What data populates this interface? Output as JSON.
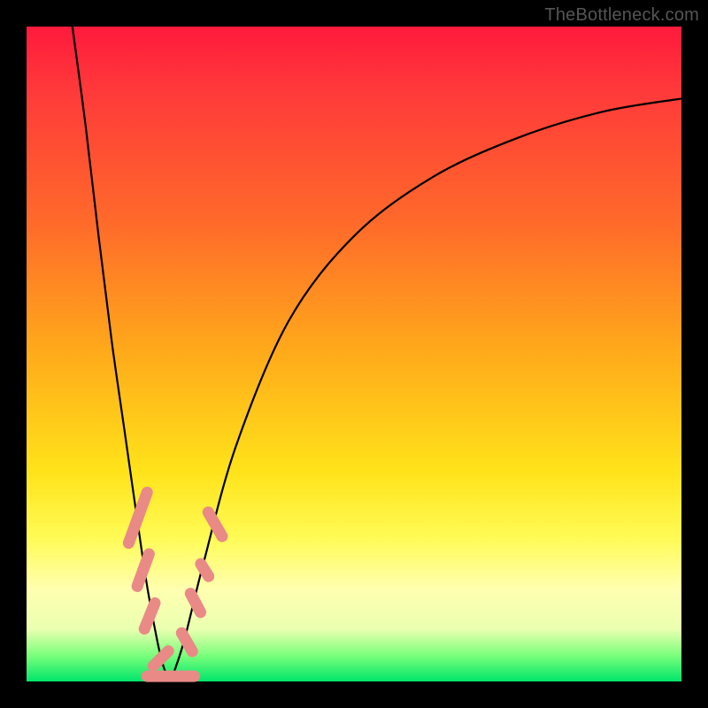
{
  "attribution": "TheBottleneck.com",
  "colors": {
    "frame": "#000000",
    "attribution_text": "#555555",
    "curve": "#000000",
    "marker": "#e98a87",
    "gradient_stops": [
      "#ff1a3c",
      "#ff3a3a",
      "#ff6a2a",
      "#ffab1a",
      "#ffe31a",
      "#fffb55",
      "#ffffb0",
      "#eaffb0",
      "#7bff7b",
      "#00e66a"
    ]
  },
  "chart_data": {
    "type": "line",
    "title": "",
    "xlabel": "",
    "ylabel": "",
    "xlim": [
      0,
      100
    ],
    "ylim": [
      0,
      100
    ],
    "note": "Axes are implied by the square plot area; no tick labels shown. Values below are in percent of the plot area: x left→right, y is height above the bottom (0 = green bottom edge, 100 = top red edge).",
    "series": [
      {
        "name": "left-branch",
        "x": [
          7,
          9,
          11,
          13,
          15,
          17,
          18.5,
          20,
          21,
          22
        ],
        "values": [
          100,
          85,
          68,
          52,
          38,
          24,
          14,
          6,
          2,
          0
        ]
      },
      {
        "name": "right-branch",
        "x": [
          22,
          24,
          27,
          32,
          40,
          50,
          62,
          75,
          88,
          100
        ],
        "values": [
          0,
          6,
          18,
          36,
          55,
          68,
          77,
          83,
          87,
          89
        ]
      }
    ],
    "markers": {
      "name": "pink-blobs",
      "description": "Salmon-colored capsule markers clustered near the trough on both branches.",
      "points": [
        {
          "x": 17.0,
          "y": 25,
          "len": 10,
          "angle": -70
        },
        {
          "x": 17.8,
          "y": 17,
          "len": 7,
          "angle": -70
        },
        {
          "x": 18.8,
          "y": 10,
          "len": 6,
          "angle": -68
        },
        {
          "x": 20.5,
          "y": 3.5,
          "len": 5,
          "angle": -45
        },
        {
          "x": 22.0,
          "y": 0.8,
          "len": 9,
          "angle": 0
        },
        {
          "x": 24.5,
          "y": 6,
          "len": 5,
          "angle": 60
        },
        {
          "x": 25.8,
          "y": 12,
          "len": 5,
          "angle": 62
        },
        {
          "x": 27.2,
          "y": 17,
          "len": 4,
          "angle": 58
        },
        {
          "x": 28.8,
          "y": 24,
          "len": 6,
          "angle": 60
        }
      ]
    }
  }
}
